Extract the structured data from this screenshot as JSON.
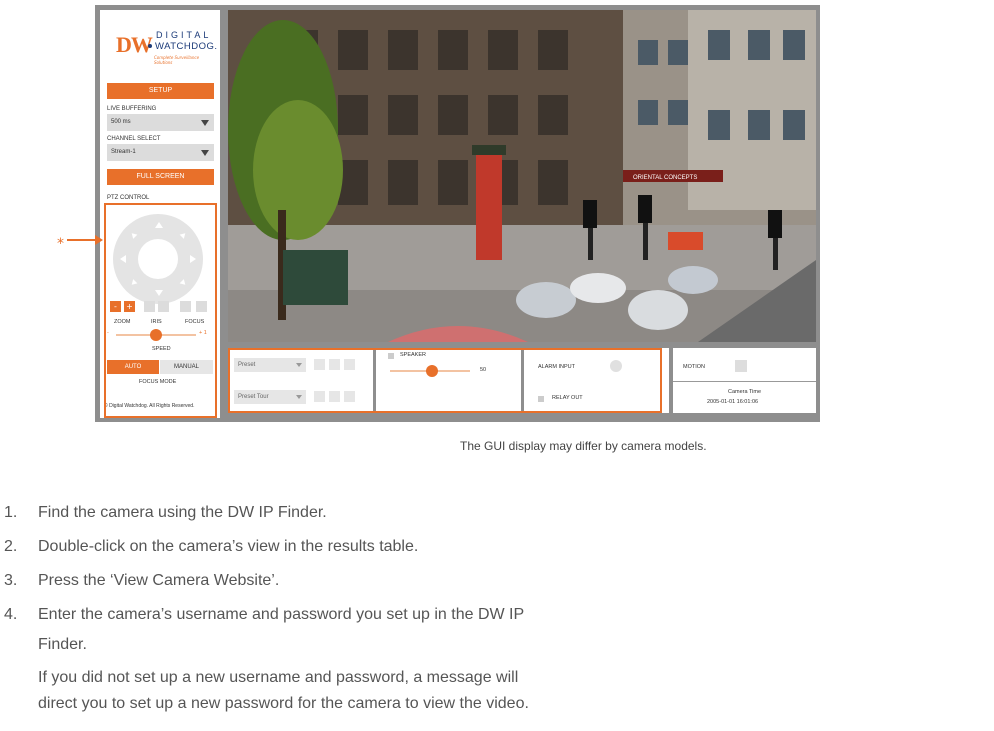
{
  "brand": {
    "logo_mark": "DW",
    "logo_line1": "DIGITAL",
    "logo_line2": "WATCHDOG.",
    "tagline": "Complete Surveillance Solutions",
    "accent_color": "#e8702a"
  },
  "sidebar": {
    "setup_label": "SETUP",
    "live_buffering_label": "LIVE BUFFERING",
    "live_buffering_value": "500 ms",
    "channel_select_label": "CHANNEL SELECT",
    "channel_select_value": "Stream-1",
    "full_screen_label": "FULL SCREEN",
    "ptz_label": "PTZ CONTROL",
    "zoom_label": "ZOOM",
    "iris_label": "IRIS",
    "focus_label": "FOCUS",
    "speed_minus": "-",
    "speed_plus": "+ 1",
    "speed_label": "SPEED",
    "focus_auto": "AUTO",
    "focus_manual": "MANUAL",
    "focus_mode_label": "FOCUS MODE",
    "copyright": "© Digital Watchdog. All Rights Reserved."
  },
  "annotation_mark": "*",
  "bottom": {
    "preset_label": "Preset",
    "preset_tour_label": "Preset Tour",
    "speaker_label": "SPEAKER",
    "speaker_value": "50",
    "alarm_input_label": "ALARM INPUT",
    "relay_out_label": "RELAY OUT",
    "motion_label": "MOTION",
    "camera_time_label": "Camera Time",
    "camera_time_value": "2005-01-01 16:01:06"
  },
  "video_sign": "ORIENTAL CONCEPTS",
  "caption": "The GUI display may differ by camera models.",
  "steps": [
    {
      "num": "1.",
      "text": "Find the camera using the DW IP Finder."
    },
    {
      "num": "2.",
      "text": "Double-click on the camera’s view in the results table."
    },
    {
      "num": "3.",
      "text": "Press the ‘View Camera Website’."
    },
    {
      "num": "4.",
      "text": "Enter the camera’s username and password you set up in the DW IP"
    }
  ],
  "step4_cont": "Finder.",
  "note_line1": "If you did not set up a new username and password, a message will",
  "note_line2": "direct you to set up a new password for the camera to view the video."
}
